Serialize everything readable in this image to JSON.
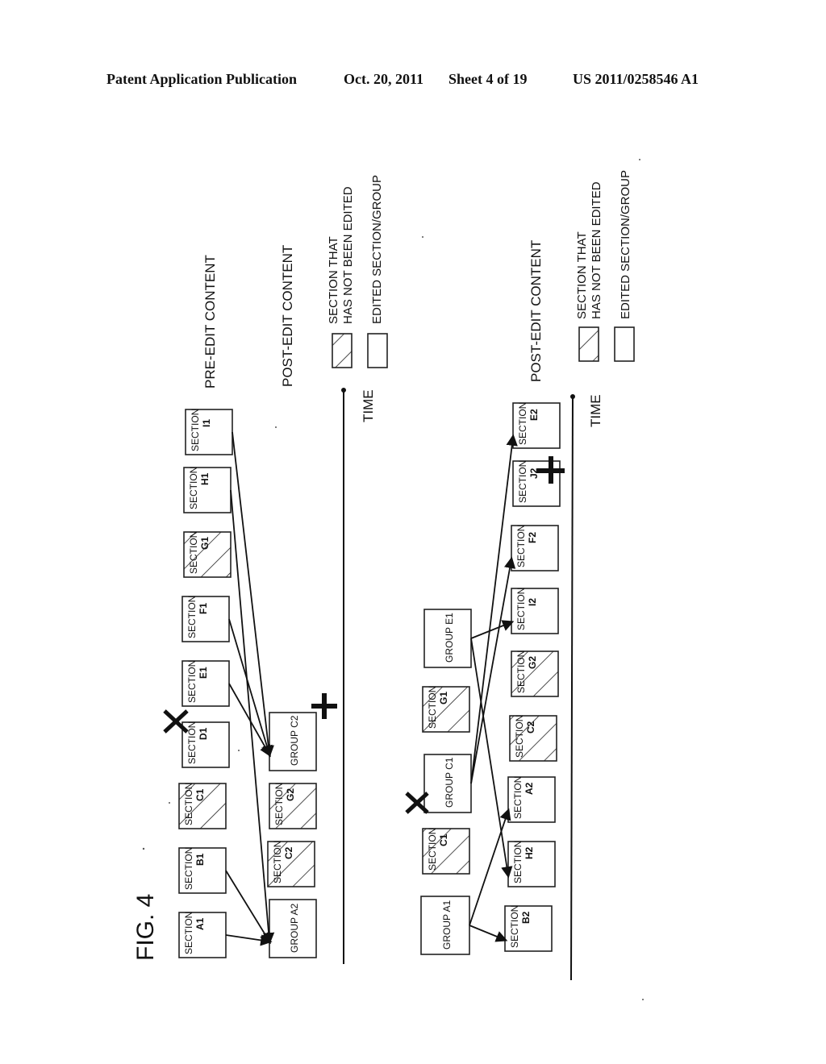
{
  "header": {
    "publication": "Patent Application Publication",
    "date": "Oct. 20, 2011",
    "sheet": "Sheet 4 of 19",
    "number": "US 2011/0258546 A1"
  },
  "figure": {
    "label": "FIG. 4",
    "axis_label": "TIME",
    "legend": {
      "unedited_line1": "SECTION THAT",
      "unedited_line2": "HAS NOT BEEN EDITED",
      "edited": "EDITED SECTION/GROUP"
    },
    "top": {
      "pre_edit_title": "PRE-EDIT CONTENT",
      "post_edit_title": "POST-EDIT CONTENT",
      "pre_edit_items": [
        {
          "kind": "SECTION",
          "id": "A1",
          "hatched": false
        },
        {
          "kind": "SECTION",
          "id": "B1",
          "hatched": false
        },
        {
          "kind": "SECTION",
          "id": "C1",
          "hatched": true
        },
        {
          "kind": "SECTION",
          "id": "D1",
          "hatched": false,
          "mark": "deleted"
        },
        {
          "kind": "SECTION",
          "id": "E1",
          "hatched": false
        },
        {
          "kind": "SECTION",
          "id": "F1",
          "hatched": false
        },
        {
          "kind": "SECTION",
          "id": "G1",
          "hatched": true
        },
        {
          "kind": "SECTION",
          "id": "H1",
          "hatched": false
        },
        {
          "kind": "SECTION",
          "id": "I1",
          "hatched": false
        }
      ],
      "post_edit_items": [
        {
          "kind": "GROUP",
          "id": "A2",
          "hatched": false
        },
        {
          "kind": "SECTION",
          "id": "C2",
          "hatched": true
        },
        {
          "kind": "SECTION",
          "id": "G2",
          "hatched": true
        },
        {
          "kind": "GROUP",
          "id": "C2",
          "hatched": false,
          "mark": "added"
        }
      ],
      "connections": [
        {
          "from": "A1",
          "to": "GROUP A2"
        },
        {
          "from": "B1",
          "to": "GROUP A2"
        },
        {
          "from": "H1",
          "to": "GROUP A2"
        },
        {
          "from": "E1",
          "to": "GROUP C2"
        },
        {
          "from": "F1",
          "to": "GROUP C2"
        },
        {
          "from": "I1",
          "to": "GROUP C2"
        }
      ]
    },
    "bottom": {
      "post_edit_title": "POST-EDIT CONTENT",
      "pre_edit_items": [
        {
          "kind": "GROUP",
          "id": "A1",
          "hatched": false
        },
        {
          "kind": "SECTION",
          "id": "C1",
          "hatched": true
        },
        {
          "kind": "GROUP",
          "id": "C1",
          "hatched": false,
          "mark": "deleted"
        },
        {
          "kind": "SECTION",
          "id": "G1",
          "hatched": true
        },
        {
          "kind": "GROUP",
          "id": "E1",
          "hatched": false
        }
      ],
      "post_edit_items": [
        {
          "kind": "SECTION",
          "id": "B2",
          "hatched": false
        },
        {
          "kind": "SECTION",
          "id": "H2",
          "hatched": false
        },
        {
          "kind": "SECTION",
          "id": "A2",
          "hatched": false
        },
        {
          "kind": "SECTION",
          "id": "C2",
          "hatched": true
        },
        {
          "kind": "SECTION",
          "id": "G2",
          "hatched": true
        },
        {
          "kind": "SECTION",
          "id": "I2",
          "hatched": false
        },
        {
          "kind": "SECTION",
          "id": "F2",
          "hatched": false
        },
        {
          "kind": "SECTION",
          "id": "J2",
          "hatched": false,
          "mark": "added"
        },
        {
          "kind": "SECTION",
          "id": "E2",
          "hatched": false
        }
      ],
      "connections": [
        {
          "from": "GROUP A1",
          "to": "B2"
        },
        {
          "from": "GROUP A1",
          "to": "A2"
        },
        {
          "from": "GROUP C1",
          "to": "F2"
        },
        {
          "from": "GROUP C1",
          "to": "E2"
        },
        {
          "from": "GROUP E1",
          "to": "I2"
        },
        {
          "from": "GROUP E1",
          "to": "H2"
        }
      ]
    }
  }
}
